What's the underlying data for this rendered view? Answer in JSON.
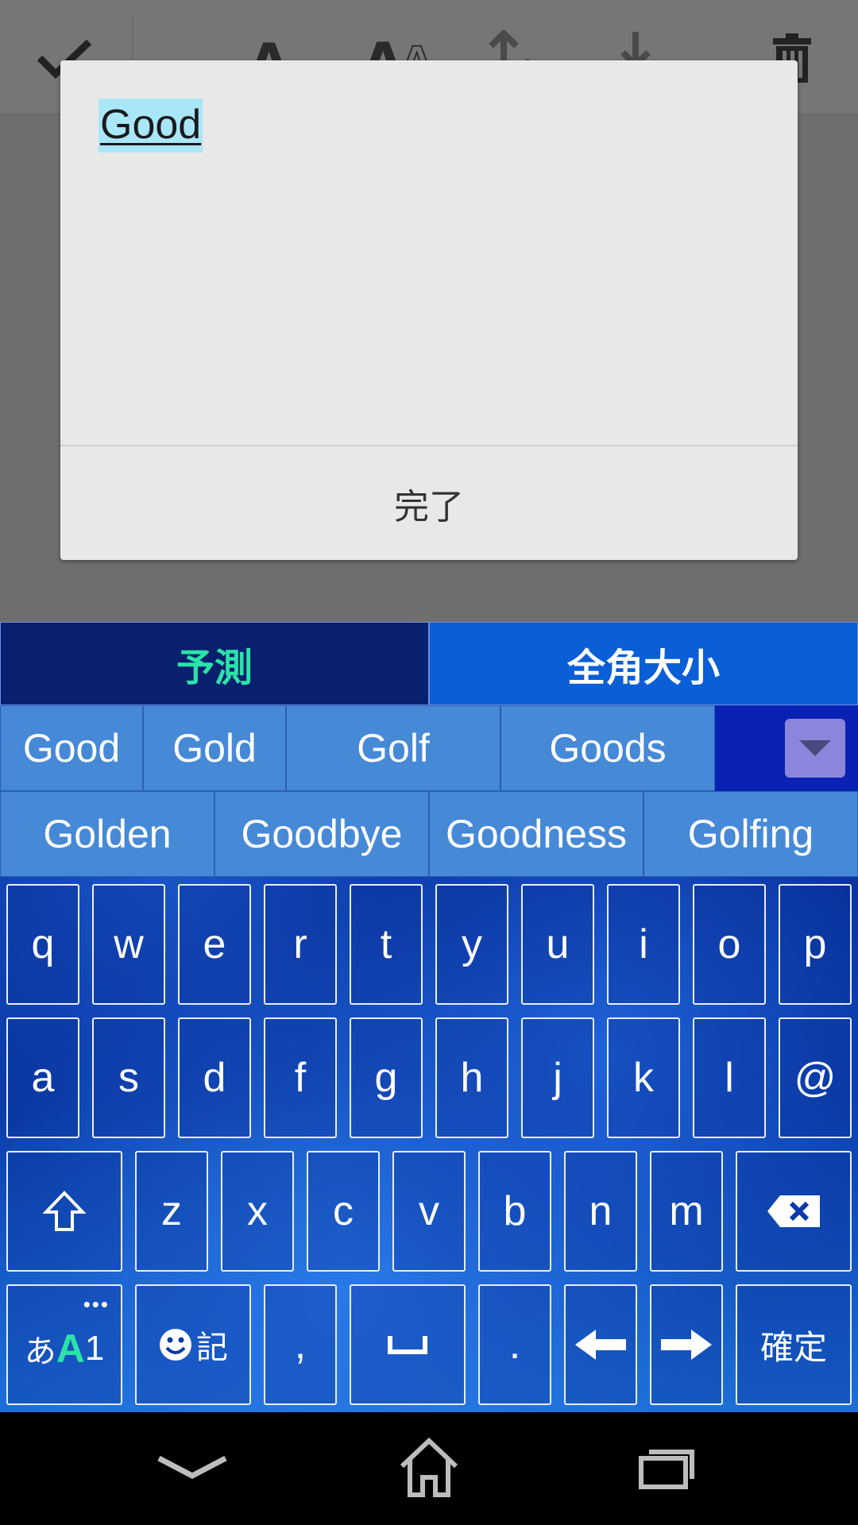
{
  "dialog": {
    "text": "Good",
    "done_label": "完了"
  },
  "keyboard": {
    "tabs": [
      "予測",
      "全角大小"
    ],
    "candidates_row1": [
      "Good",
      "Gold",
      "Golf",
      "Goods"
    ],
    "candidates_row2": [
      "Golden",
      "Goodbye",
      "Goodness",
      "Golfing"
    ],
    "row1": [
      "q",
      "w",
      "e",
      "r",
      "t",
      "y",
      "u",
      "i",
      "o",
      "p"
    ],
    "row2": [
      "a",
      "s",
      "d",
      "f",
      "g",
      "h",
      "j",
      "k",
      "l",
      "@"
    ],
    "row3": [
      "z",
      "x",
      "c",
      "v",
      "b",
      "n",
      "m"
    ],
    "row4": {
      "mode_hira": "あ",
      "mode_alpha": "A",
      "mode_num": "1",
      "symbol_label": "記",
      "comma": ",",
      "period": ".",
      "confirm": "確定"
    },
    "colors": {
      "predict_tab_text": "#2be3a8",
      "mode_alpha_color": "#2be3a8"
    }
  },
  "icons": {
    "toolbar": [
      "check-icon",
      "font-size-small-icon",
      "font-size-large-icon",
      "bring-forward-icon",
      "send-backward-icon",
      "trash-icon"
    ],
    "keyboard": [
      "shift-icon",
      "backspace-icon",
      "smiley-icon",
      "space-icon",
      "arrow-left-icon",
      "arrow-right-icon",
      "chevron-down-icon"
    ],
    "nav": [
      "back-icon",
      "home-icon",
      "recent-apps-icon"
    ]
  }
}
